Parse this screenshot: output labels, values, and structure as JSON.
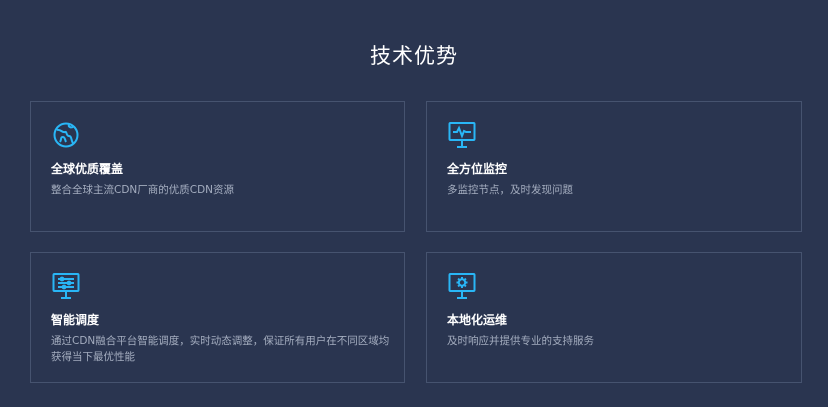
{
  "section": {
    "title": "技术优势"
  },
  "colors": {
    "background": "#2a3550",
    "card_border": "#46536f",
    "accent": "#29b6f6",
    "title": "#ffffff",
    "description": "#a4adbf"
  },
  "cards": [
    {
      "icon": "globe-icon",
      "title": "全球优质覆盖",
      "description": "整合全球主流CDN厂商的优质CDN资源"
    },
    {
      "icon": "monitor-pulse-icon",
      "title": "全方位监控",
      "description": "多监控节点，及时发现问题"
    },
    {
      "icon": "monitor-sliders-icon",
      "title": "智能调度",
      "description": "通过CDN融合平台智能调度，实时动态调整，保证所有用户在不同区域均获得当下最优性能"
    },
    {
      "icon": "monitor-gear-icon",
      "title": "本地化运维",
      "description": "及时响应并提供专业的支持服务"
    }
  ]
}
